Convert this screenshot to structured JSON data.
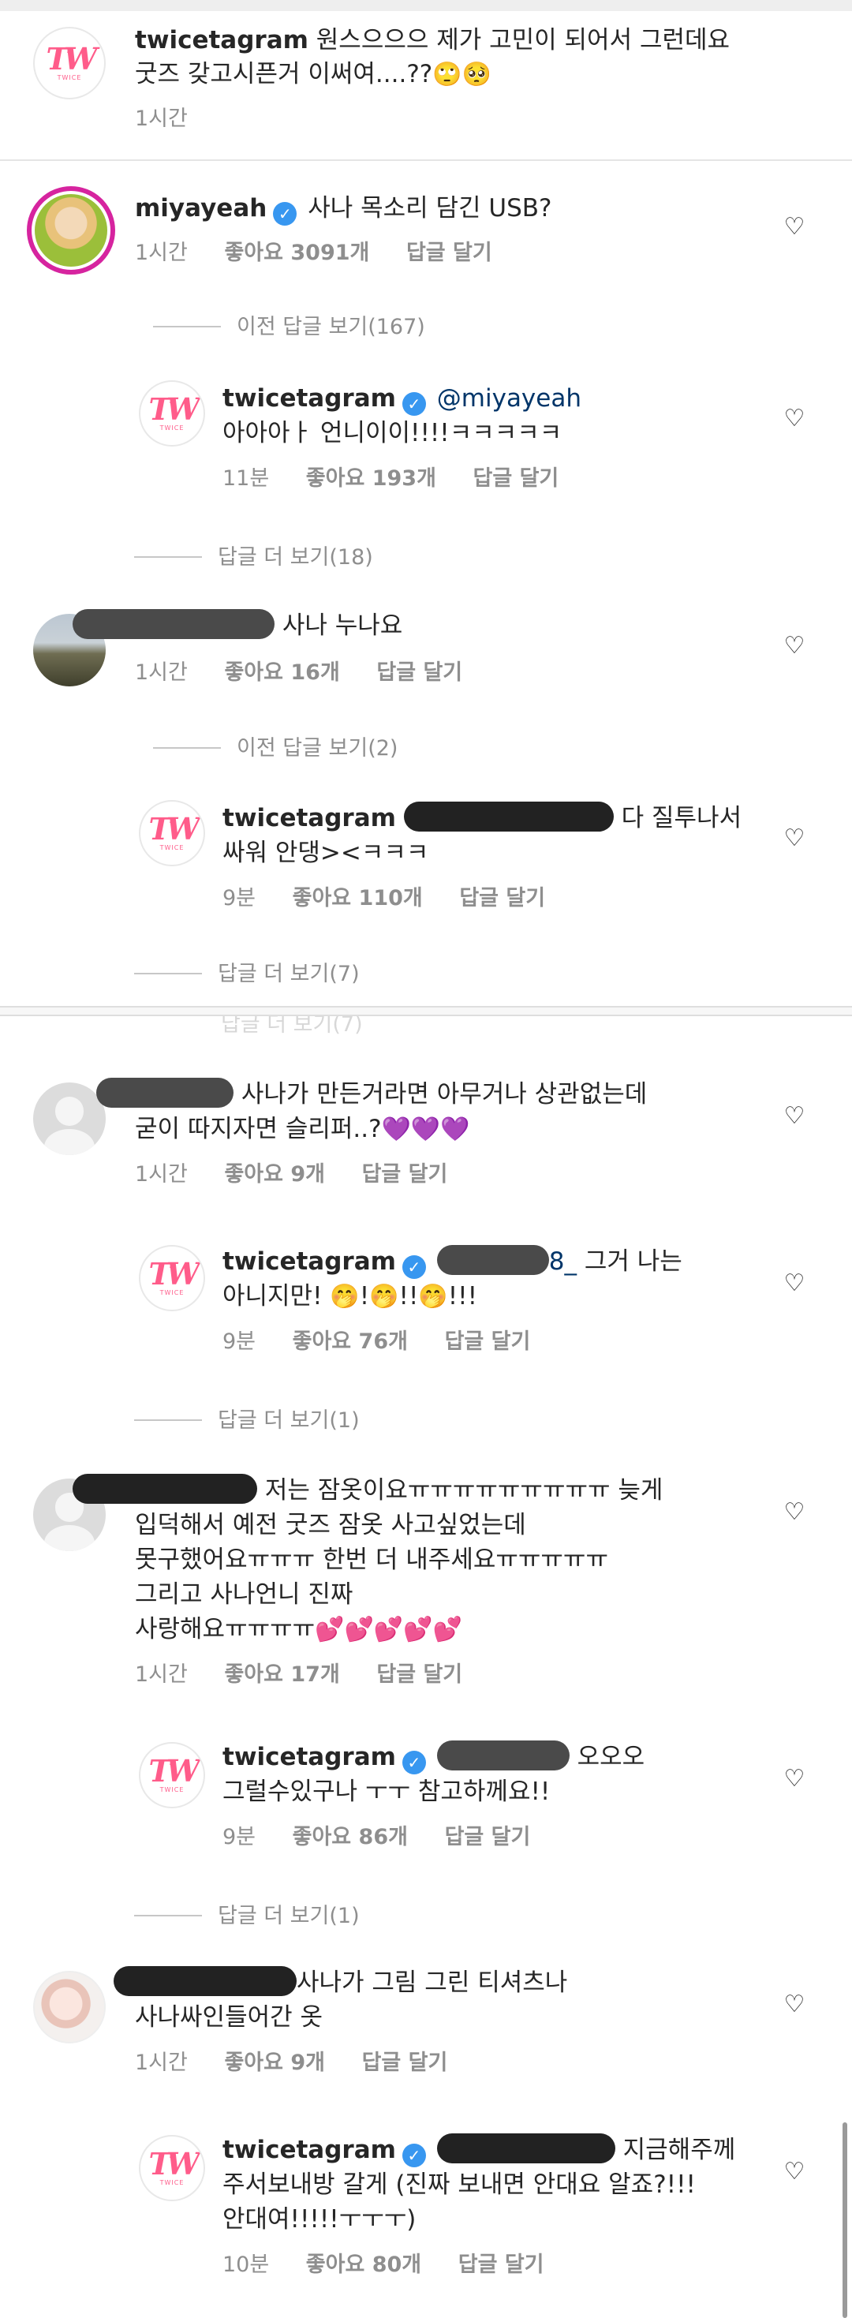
{
  "screenshot1": {
    "c1": {
      "username": "twicetagram",
      "text1": "원스으으으 제가 고민이 되어서 그런데요",
      "text2": "굿즈 갖고시픈거 이써여....??",
      "emoji": "🙄🥺",
      "time": "1시간"
    },
    "c2": {
      "username": "miyayeah",
      "text": "사나 목소리 담긴 USB?",
      "time": "1시간",
      "likes": "좋아요 3091개",
      "reply": "답글 달기",
      "view_prev": "이전 답글 보기(167)"
    },
    "r1": {
      "username": "twicetagram",
      "mention": "@miyayeah",
      "text": "아아아ㅏ 언니이이!!!!ㅋㅋㅋㅋㅋ",
      "time": "11분",
      "likes": "좋아요 193개",
      "reply": "답글 달기",
      "view_more": "답글 더 보기(18)"
    },
    "c3": {
      "text": "사나 누나요",
      "time": "1시간",
      "likes": "좋아요 16개",
      "reply": "답글 달기",
      "view_prev": "이전 답글 보기(2)"
    },
    "r2": {
      "username": "twicetagram",
      "text1": "다 질투나서",
      "text2": "싸워 안댕><ㅋㅋㅋ",
      "time": "9분",
      "likes": "좋아요 110개",
      "reply": "답글 달기",
      "view_more": "답글 더 보기(7)"
    }
  },
  "screenshot2": {
    "cut_text": "답글 더 보기(7)",
    "c4": {
      "text1": "사나가 만든거라면 아무거나 상관없는데",
      "text2": "굳이 따지자면 슬리퍼..?",
      "emoji": "💜💜💜",
      "time": "1시간",
      "likes": "좋아요 9개",
      "reply": "답글 달기"
    },
    "r3": {
      "username": "twicetagram",
      "mention_tail": "8_",
      "text1": "그거 나는",
      "text2": "아니지만!",
      "text3": "!",
      "text4": "!!",
      "text5": "!!!",
      "emoji": "🤭",
      "time": "9분",
      "likes": "좋아요 76개",
      "reply": "답글 달기",
      "view_more": "답글 더 보기(1)"
    },
    "c5": {
      "text1": "저는 잠옷이요ㅠㅠㅠㅠㅠㅠㅠㅠㅠ 늦게",
      "text2": "입덕해서 예전 굿즈 잠옷 사고싶었는데",
      "text3": "못구했어요ㅠㅠㅠ 한번 더 내주세요ㅠㅠㅠㅠㅠ",
      "text4": "그리고 사나언니 진짜",
      "text5": "사랑해요ㅠㅠㅠㅠ",
      "emoji": "💕💕💕💕💕",
      "time": "1시간",
      "likes": "좋아요 17개",
      "reply": "답글 달기"
    },
    "r4": {
      "username": "twicetagram",
      "text1": "오오오",
      "text2": "그럴수있구나 ㅜㅜ 참고하께요!!",
      "time": "9분",
      "likes": "좋아요 86개",
      "reply": "답글 달기",
      "view_more": "답글 더 보기(1)"
    },
    "c6": {
      "text1": "사나가 그림 그린 티셔츠나",
      "text2": "사나싸인들어간 옷",
      "time": "1시간",
      "likes": "좋아요 9개",
      "reply": "답글 달기"
    },
    "r5": {
      "username": "twicetagram",
      "text1": "지금해주께",
      "text2": "주서보내방 갈게 (진짜 보내면 안대요 알죠?!!!",
      "text3": "안대여!!!!!ㅜㅜㅜ)",
      "time": "10분",
      "likes": "좋아요 80개",
      "reply": "답글 달기"
    }
  },
  "icons": {
    "heart": "heart-outline-icon",
    "verified": "verified-badge-icon",
    "avatar_logo": "twice-logo"
  },
  "avatar_logo_text": "TW",
  "avatar_logo_sub": "TWICE"
}
